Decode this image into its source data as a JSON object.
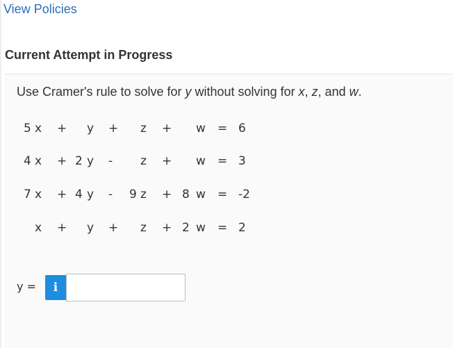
{
  "header": {
    "policies_link": "View Policies"
  },
  "section": {
    "title": "Current Attempt in Progress"
  },
  "problem": {
    "prompt_parts": [
      "Use Cramer's rule to solve for ",
      "y",
      " without solving for ",
      "x",
      ", ",
      "z",
      ", and ",
      "w",
      "."
    ],
    "equations": [
      [
        "5",
        "x",
        "+",
        "",
        "y",
        "+",
        "",
        "z",
        "+",
        "",
        "w",
        "=",
        "6"
      ],
      [
        "4",
        "x",
        "+",
        "2",
        "y",
        "-",
        "",
        "z",
        "+",
        "",
        "w",
        "=",
        "3"
      ],
      [
        "7",
        "x",
        "+",
        "4",
        "y",
        "-",
        "9",
        "z",
        "+",
        "8",
        "w",
        "=",
        "-2"
      ],
      [
        "",
        "x",
        "+",
        "",
        "y",
        "+",
        "",
        "z",
        "+",
        "2",
        "w",
        "=",
        "2"
      ]
    ]
  },
  "answer": {
    "label": "y =",
    "info_icon": "i",
    "info_icon_name": "info-icon",
    "value": ""
  },
  "colors": {
    "link": "#2a6ebb",
    "info_button": "#1f8ddf",
    "panel_background": "#fafafa"
  }
}
